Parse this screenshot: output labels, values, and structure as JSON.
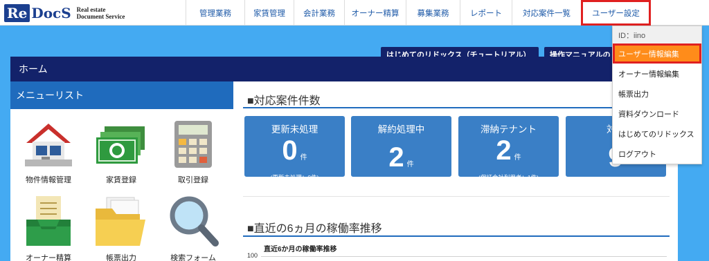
{
  "logo": {
    "mark": "Re",
    "name": "DocS",
    "sub_line1": "Real estate",
    "sub_line2": "Document Service"
  },
  "nav": [
    {
      "label": "管理業務"
    },
    {
      "label": "家賃管理"
    },
    {
      "label": "会計業務"
    },
    {
      "label": "オーナー精算"
    },
    {
      "label": "募集業務"
    },
    {
      "label": "レポート"
    },
    {
      "label": "対応案件一覧"
    },
    {
      "label": "ユーザー設定"
    }
  ],
  "tabs": {
    "tutorial": "はじめてのリドックス（チュートリアル）",
    "manual": "操作マニュアルの"
  },
  "home_title": "ホーム",
  "sidebar": {
    "title": "メニューリスト",
    "items": [
      {
        "label": "物件情報管理",
        "icon": "house-icon"
      },
      {
        "label": "家賃登録",
        "icon": "money-icon"
      },
      {
        "label": "取引登録",
        "icon": "calculator-icon"
      },
      {
        "label": "オーナー精算",
        "icon": "inbox-tray-icon"
      },
      {
        "label": "帳票出力",
        "icon": "folder-icon"
      },
      {
        "label": "検索フォーム",
        "icon": "magnifier-icon"
      }
    ]
  },
  "main": {
    "section1_title": "■対応案件件数",
    "cards": [
      {
        "title": "更新未処理",
        "value": "0",
        "unit": "件",
        "note": "(更新未処理：0件)"
      },
      {
        "title": "解約処理中",
        "value": "2",
        "unit": "件",
        "note": ""
      },
      {
        "title": "滞納テナント",
        "value": "2",
        "unit": "件",
        "note": "(保証会社利用者：1件)"
      },
      {
        "title": "対応",
        "value": "9",
        "unit": "",
        "note": ""
      }
    ],
    "section2_title": "■直近の6ヵ月の稼働率推移",
    "chart_title": "直近6か月の稼働率推移",
    "chart_axis_top": "100"
  },
  "dropdown": {
    "id_label": "ID：iino",
    "items": [
      {
        "label": "ユーザー情報編集"
      },
      {
        "label": "オーナー情報編集"
      },
      {
        "label": "帳票出力"
      },
      {
        "label": "資料ダウンロード"
      },
      {
        "label": "はじめてのリドックス"
      },
      {
        "label": "ログアウト"
      }
    ]
  },
  "colors": {
    "stage": "#44aaf2",
    "navy": "#13226a",
    "card": "#3a7fc6",
    "highlight": "#ff8c1a",
    "outline": "#e02020"
  }
}
